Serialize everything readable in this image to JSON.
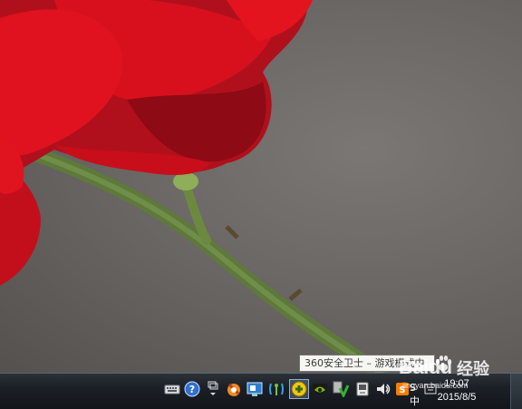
{
  "tooltip": {
    "text": "360安全卫士 – 游戏模式中"
  },
  "clock": {
    "time": "19:07",
    "date": "2015/8/5"
  },
  "watermark": {
    "logo": "Baidu",
    "product": "经验",
    "url": "jingyan.baidu.com"
  },
  "tray": {
    "icons": [
      "keyboard-icon",
      "help-icon",
      "window-arrow-icon",
      "security-icon",
      "network-monitor-icon",
      "wireless-icon",
      "game-mode-icon",
      "nvidia-icon",
      "shield-check-icon",
      "device-icon",
      "volume-icon",
      "sogou-input-icon",
      "action-center-icon"
    ],
    "input_label": "S中"
  }
}
